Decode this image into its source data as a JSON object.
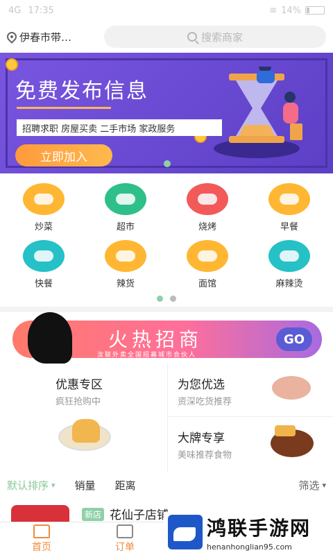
{
  "status_bar": {
    "carrier": "4G",
    "time": "17:35",
    "battery": "14%"
  },
  "header": {
    "location": "伊春市带…",
    "search_placeholder": "搜索商家"
  },
  "banner": {
    "title": "免费发布信息",
    "tags": "招聘求职 房屋买卖 二手市场 家政服务",
    "button": "立即加入"
  },
  "categories": [
    {
      "label": "炒菜",
      "color": "#ffb733",
      "icon": "wok-icon"
    },
    {
      "label": "超市",
      "color": "#2fbf8a",
      "icon": "cabbage-icon"
    },
    {
      "label": "烧烤",
      "color": "#f25a5a",
      "icon": "skewer-icon"
    },
    {
      "label": "早餐",
      "color": "#ffb733",
      "icon": "egg-icon"
    },
    {
      "label": "快餐",
      "color": "#25c1c7",
      "icon": "burger-icon"
    },
    {
      "label": "辣货",
      "color": "#ffb733",
      "icon": "crayfish-icon"
    },
    {
      "label": "面馆",
      "color": "#ffb733",
      "icon": "noodle-bowl-icon"
    },
    {
      "label": "麻辣烫",
      "color": "#25c1c7",
      "icon": "hotpot-icon"
    }
  ],
  "promo": {
    "title": "火热招商",
    "subtitle": "汝联外卖全国招募城市合伙人",
    "go": "GO"
  },
  "specials": {
    "left": {
      "title": "优惠专区",
      "subtitle": "疯狂抢购中"
    },
    "right_top": {
      "title": "为您优选",
      "subtitle": "资深吃货推荐"
    },
    "right_bottom": {
      "title": "大牌专享",
      "subtitle": "美味推荐食物"
    }
  },
  "sort": {
    "default": "默认排序",
    "sales": "销量",
    "distance": "距离",
    "filter": "筛选"
  },
  "shop": {
    "badge": "新店",
    "name": "花仙子店铺"
  },
  "tabs": {
    "home": "首页",
    "orders": "订单"
  },
  "watermark": {
    "name": "鸿联手游网",
    "url": "henanhonglian95.com"
  }
}
